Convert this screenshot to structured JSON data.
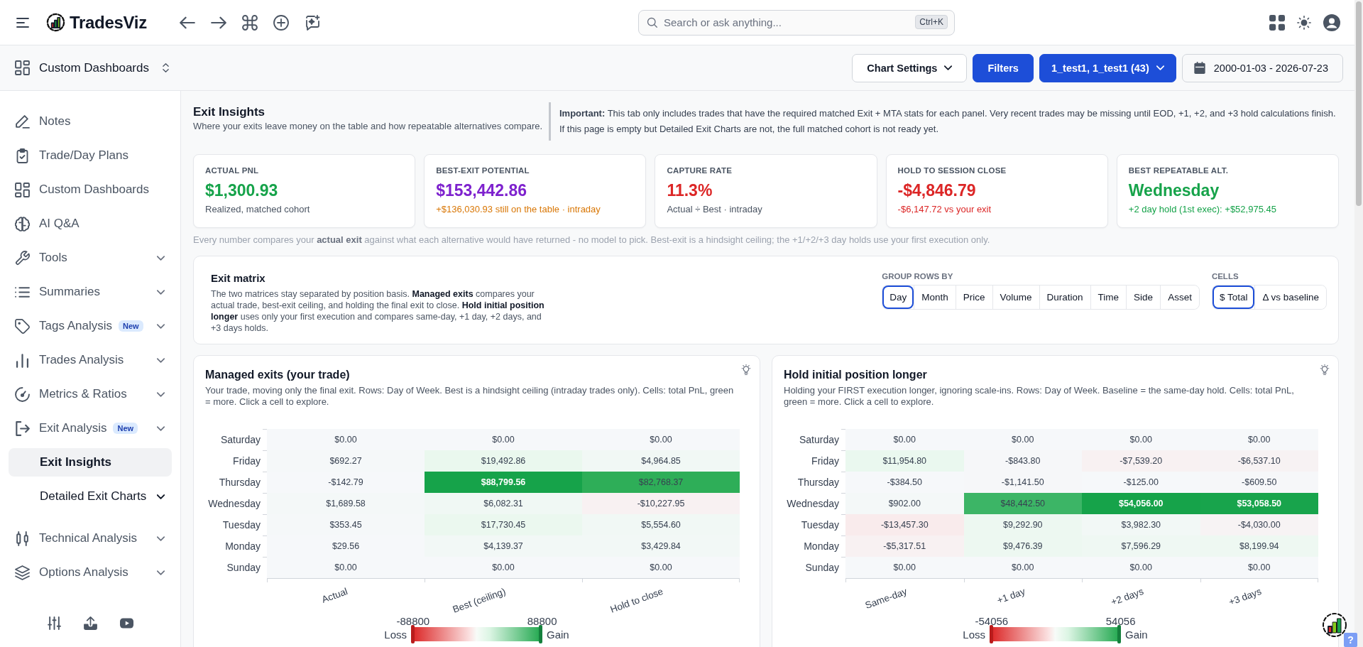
{
  "header": {
    "logo": "TradesViz",
    "search": {
      "placeholder": "Search or ask anything...",
      "shortcut": "Ctrl+K"
    }
  },
  "toolbar": {
    "dashboard": "Custom Dashboards",
    "buttons": [
      {
        "label": "Chart Settings",
        "kind": "outline_menu"
      },
      {
        "label": "Filters",
        "kind": "primary"
      },
      {
        "label": "1_test1, 1_test1 (43)",
        "kind": "primary_menu"
      }
    ],
    "date_range": "2000-01-03 - 2026-07-23"
  },
  "sidebar": {
    "items": [
      {
        "label": "Notes",
        "kind": "link",
        "selected": false
      },
      {
        "label": "Trade/Day Plans",
        "kind": "link",
        "selected": false
      },
      {
        "label": "Custom Dashboards",
        "kind": "link",
        "selected": false
      },
      {
        "label": "AI Q&A",
        "kind": "link",
        "selected": false
      },
      {
        "label": "Tools",
        "kind": "group",
        "selected": false
      },
      {
        "label": "Summaries",
        "kind": "group",
        "selected": false
      },
      {
        "label": "Tags Analysis",
        "kind": "group",
        "badge": "New",
        "selected": false
      },
      {
        "label": "Trades Analysis",
        "kind": "group",
        "selected": false
      },
      {
        "label": "Metrics & Ratios",
        "kind": "group",
        "selected": false
      },
      {
        "label": "Exit Analysis",
        "kind": "group",
        "badge": "New",
        "selected": false,
        "children": [
          {
            "label": "Exit Insights",
            "kind": "link",
            "selected": true
          },
          {
            "label": "Detailed Exit Charts",
            "kind": "group",
            "selected": false
          }
        ]
      },
      {
        "label": "Technical Analysis",
        "kind": "group",
        "selected": false
      },
      {
        "label": "Options Analysis",
        "kind": "group",
        "selected": false
      }
    ]
  },
  "insights": {
    "title": "Exit Insights",
    "subtitle": "Where your exits leave money on the table and how repeatable alternatives compare.",
    "notice": "**Important:** This tab only includes trades that have the required matched Exit + MTA stats for each panel. Very recent trades may be missing until EOD, +1, +2, and +3 hold calculations finish. If this page is empty but Detailed Exit Charts are not, the full matched cohort is not ready yet."
  },
  "stats": [
    {
      "label": "ACTUAL PNL",
      "value": "$1,300.93",
      "color": "#16a34a",
      "note": {
        "text": "Realized, matched cohort",
        "color": "#4b5563"
      }
    },
    {
      "label": "BEST-EXIT POTENTIAL",
      "value": "$153,442.86",
      "color": "#7e22ce",
      "note": {
        "text": "+$136,030.93 still on the table · intraday",
        "color": "#d97706"
      }
    },
    {
      "label": "CAPTURE RATE",
      "value": "11.3%",
      "color": "#dc2626",
      "note": {
        "text": "Actual ÷ Best · intraday",
        "color": "#4b5563"
      }
    },
    {
      "label": "HOLD TO SESSION CLOSE",
      "value": "-$4,846.79",
      "color": "#dc2626",
      "note": {
        "text": "-$6,147.72 vs your exit",
        "color": "#dc2626"
      }
    },
    {
      "label": "BEST REPEATABLE ALT.",
      "value": "Wednesday",
      "color": "#16a34a",
      "note": {
        "text": "+2 day hold (1st exec): +$52,975.45",
        "color": "#16a34a"
      }
    }
  ],
  "footnote": "Every number compares your **actual exit** against what each alternative would have returned - no model to pick. Best-exit is a hindsight ceiling; the +1/+2/+3 day holds use your first execution only.",
  "matrix": {
    "title": "Exit matrix",
    "description": "The two matrices stay separated by position basis. **Managed exits** compares your actual trade, best-exit ceiling, and holding the final exit to close. **Hold initial position longer** uses only your first execution and compares same-day, +1 day, +2 days, and +3 days holds.",
    "group_rows_by": {
      "label": "GROUP ROWS BY",
      "options": [
        {
          "label": "Day",
          "selected": true
        },
        {
          "label": "Month",
          "selected": false
        },
        {
          "label": "Price",
          "selected": false
        },
        {
          "label": "Volume",
          "selected": false
        },
        {
          "label": "Duration",
          "selected": false
        },
        {
          "label": "Time",
          "selected": false
        },
        {
          "label": "Side",
          "selected": false
        },
        {
          "label": "Asset",
          "selected": false
        }
      ]
    },
    "cells": {
      "label": "CELLS",
      "options": [
        {
          "label": "$ Total",
          "selected": true
        },
        {
          "label": "Δ vs baseline",
          "selected": false
        }
      ]
    }
  },
  "panels": [
    {
      "title": "Managed exits (your trade)",
      "description": "Your trade, moving only the final exit. Rows: Day of Week. Best is a hindsight ceiling (intraday trades only). Cells: total PnL, green = more. Click a cell to explore.",
      "rows": [
        {
          "label": "Saturday",
          "cells": [
            {
              "value": "$0.00",
              "color": "#f6f8fa"
            },
            {
              "value": "$0.00",
              "color": "#f6f8fa"
            },
            {
              "value": "$0.00",
              "color": "#f6f8fa"
            }
          ]
        },
        {
          "label": "Friday",
          "cells": [
            {
              "value": "$692.27",
              "color": "#f5f8f9"
            },
            {
              "value": "$19,492.86",
              "color": "#eaf8ee"
            },
            {
              "value": "$4,964.85",
              "color": "#f1f8f5"
            }
          ]
        },
        {
          "label": "Thursday",
          "cells": [
            {
              "value": "-$142.79",
              "color": "#f6f8fa"
            },
            {
              "value": "$88,799.56",
              "color": "#16a34a"
            },
            {
              "value": "$82,768.37",
              "color": "#2eae58"
            }
          ]
        },
        {
          "label": "Wednesday",
          "cells": [
            {
              "value": "$1,689.58",
              "color": "#f4f8f8"
            },
            {
              "value": "$6,082.31",
              "color": "#f0f8f4"
            },
            {
              "value": "-$10,227.95",
              "color": "#f8f1f2"
            }
          ]
        },
        {
          "label": "Tuesday",
          "cells": [
            {
              "value": "$353.45",
              "color": "#f5f8f9"
            },
            {
              "value": "$17,730.45",
              "color": "#ebf8ef"
            },
            {
              "value": "$5,554.60",
              "color": "#f1f8f5"
            }
          ]
        },
        {
          "label": "Monday",
          "cells": [
            {
              "value": "$29.56",
              "color": "#f6f8fa"
            },
            {
              "value": "$4,139.37",
              "color": "#f2f8f6"
            },
            {
              "value": "$3,429.84",
              "color": "#f2f8f6"
            }
          ]
        },
        {
          "label": "Sunday",
          "cells": [
            {
              "value": "$0.00",
              "color": "#f6f8fa"
            },
            {
              "value": "$0.00",
              "color": "#f6f8fa"
            },
            {
              "value": "$0.00",
              "color": "#f6f8fa"
            }
          ]
        }
      ],
      "column_labels": [
        "Actual",
        "Best (ceiling)",
        "Hold to close"
      ],
      "legend": {
        "min": "-88800",
        "max": "88800",
        "low_label": "Loss",
        "high_label": "Gain"
      }
    },
    {
      "title": "Hold initial position longer",
      "description": "Holding your FIRST execution longer, ignoring scale-ins. Rows: Day of Week. Baseline = the same-day hold. Cells: total PnL, green = more. Click a cell to explore.",
      "rows": [
        {
          "label": "Saturday",
          "cells": [
            {
              "value": "$0.00",
              "color": "#f6f8fa"
            },
            {
              "value": "$0.00",
              "color": "#f6f8fa"
            },
            {
              "value": "$0.00",
              "color": "#f6f8fa"
            },
            {
              "value": "$0.00",
              "color": "#f6f8fa"
            }
          ]
        },
        {
          "label": "Friday",
          "cells": [
            {
              "value": "$11,954.80",
              "color": "#eaf8ef"
            },
            {
              "value": "-$843.80",
              "color": "#f6f7f9"
            },
            {
              "value": "-$7,539.20",
              "color": "#f8f1f2"
            },
            {
              "value": "-$6,537.10",
              "color": "#f7f2f3"
            }
          ]
        },
        {
          "label": "Thursday",
          "cells": [
            {
              "value": "-$384.50",
              "color": "#f6f8fa"
            },
            {
              "value": "-$1,141.50",
              "color": "#f6f7f9"
            },
            {
              "value": "-$125.00",
              "color": "#f6f8fa"
            },
            {
              "value": "-$609.50",
              "color": "#f6f7f9"
            }
          ]
        },
        {
          "label": "Wednesday",
          "cells": [
            {
              "value": "$902.00",
              "color": "#f4f8f8"
            },
            {
              "value": "$48,442.50",
              "color": "#3cb566"
            },
            {
              "value": "$54,056.00",
              "color": "#16a34a"
            },
            {
              "value": "$53,058.50",
              "color": "#18a44c"
            }
          ]
        },
        {
          "label": "Tuesday",
          "cells": [
            {
              "value": "-$13,457.30",
              "color": "#f9ebec"
            },
            {
              "value": "$9,292.90",
              "color": "#edf8f1"
            },
            {
              "value": "$3,982.30",
              "color": "#f2f8f6"
            },
            {
              "value": "-$4,030.00",
              "color": "#f7f3f4"
            }
          ]
        },
        {
          "label": "Monday",
          "cells": [
            {
              "value": "-$5,317.51",
              "color": "#f8f1f2"
            },
            {
              "value": "$9,476.39",
              "color": "#edf8f1"
            },
            {
              "value": "$7,596.29",
              "color": "#eff8f3"
            },
            {
              "value": "$8,199.94",
              "color": "#eef8f2"
            }
          ]
        },
        {
          "label": "Sunday",
          "cells": [
            {
              "value": "$0.00",
              "color": "#f6f8fa"
            },
            {
              "value": "$0.00",
              "color": "#f6f8fa"
            },
            {
              "value": "$0.00",
              "color": "#f6f8fa"
            },
            {
              "value": "$0.00",
              "color": "#f6f8fa"
            }
          ]
        }
      ],
      "column_labels": [
        "Same-day",
        "+1 day",
        "+2 days",
        "+3 days"
      ],
      "legend": {
        "min": "-54056",
        "max": "54056",
        "low_label": "Loss",
        "high_label": "Gain"
      }
    }
  ],
  "help": {
    "label": "?"
  }
}
